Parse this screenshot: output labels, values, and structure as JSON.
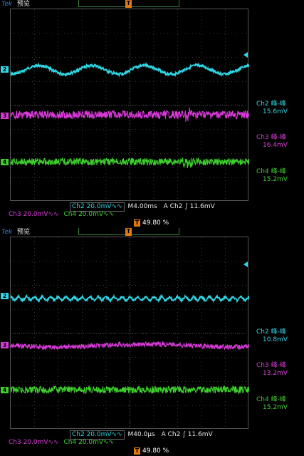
{
  "colors": {
    "ch2": "#2fd7e6",
    "ch3": "#d83ad8",
    "ch4": "#3ecf2e",
    "trigger": "#e07a10"
  },
  "panels": [
    {
      "brand": "Tek",
      "mode": "预览",
      "channels": [
        {
          "id": "2",
          "label": "2"
        },
        {
          "id": "3",
          "label": "3"
        },
        {
          "id": "4",
          "label": "4"
        }
      ],
      "measurements": [
        {
          "name": "Ch2 峰-峰",
          "value": "15.6mV"
        },
        {
          "name": "Ch3 峰-峰",
          "value": "16.4mV"
        },
        {
          "name": "Ch4 峰-峰",
          "value": "15.2mV"
        }
      ],
      "status": {
        "ch2": "Ch2  20.0mV∿∿",
        "timebase": "M4.00ms",
        "trig": "A  Ch2  ∫  11.6mV",
        "ch3": "Ch3  20.0mV∿∿",
        "ch4": "Ch4  20.0mV∿∿",
        "position": "49.80 %"
      },
      "waveform": {
        "ch2_periods": 4.5
      }
    },
    {
      "brand": "Tek",
      "mode": "预览",
      "channels": [
        {
          "id": "2",
          "label": "2"
        },
        {
          "id": "3",
          "label": "3"
        },
        {
          "id": "4",
          "label": "4"
        }
      ],
      "measurements": [
        {
          "name": "Ch2 峰-峰",
          "value": "10.8mV"
        },
        {
          "name": "Ch3 峰-峰",
          "value": "13.2mV"
        },
        {
          "name": "Ch4 峰-峰",
          "value": "15.2mV"
        }
      ],
      "status": {
        "ch2": "Ch2  20.0mV∿∿",
        "timebase": "M40.0µs",
        "trig": "A  Ch2  ∫  11.6mV",
        "ch3": "Ch3  20.0mV∿∿",
        "ch4": "Ch4  20.0mV∿∿",
        "position": "49.80 %"
      },
      "waveform": {
        "ch2_periods": 30
      }
    }
  ]
}
